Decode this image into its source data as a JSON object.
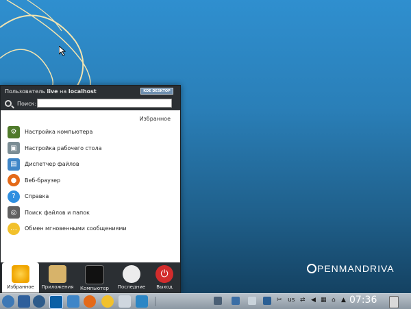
{
  "launcher": {
    "header": {
      "prefix": "Пользователь",
      "user": "live",
      "middle": "на",
      "host": "localhost",
      "kde_badge": "KDE DESKTOP"
    },
    "search": {
      "label": "Поиск:",
      "value": ""
    },
    "section_title": "Избранное",
    "items": [
      {
        "label": "Настройка компьютера",
        "icon": "computer-settings-icon",
        "color": "#4f7a2a"
      },
      {
        "label": "Настройка рабочего стола",
        "icon": "desktop-settings-icon",
        "color": "#7b8d95"
      },
      {
        "label": "Диспетчер файлов",
        "icon": "file-manager-icon",
        "color": "#3f86c8"
      },
      {
        "label": "Веб-браузер",
        "icon": "firefox-icon",
        "color": "#e46a19"
      },
      {
        "label": "Справка",
        "icon": "help-icon",
        "color": "#2f8fe0"
      },
      {
        "label": "Поиск файлов и папок",
        "icon": "search-files-icon",
        "color": "#616161"
      },
      {
        "label": "Обмен мгновенными сообщениями",
        "icon": "messaging-icon",
        "color": "#f2c12c"
      }
    ],
    "tabs": [
      {
        "label": "Избранное",
        "active": true
      },
      {
        "label": "Приложения",
        "active": false
      },
      {
        "label": "Компьютер",
        "active": false
      },
      {
        "label": "Последние",
        "active": false
      },
      {
        "label": "Выход",
        "active": false
      }
    ]
  },
  "brand": "PENMANDRIVA",
  "taskbar": {
    "tray_lang": "us",
    "clock": "07:36"
  }
}
